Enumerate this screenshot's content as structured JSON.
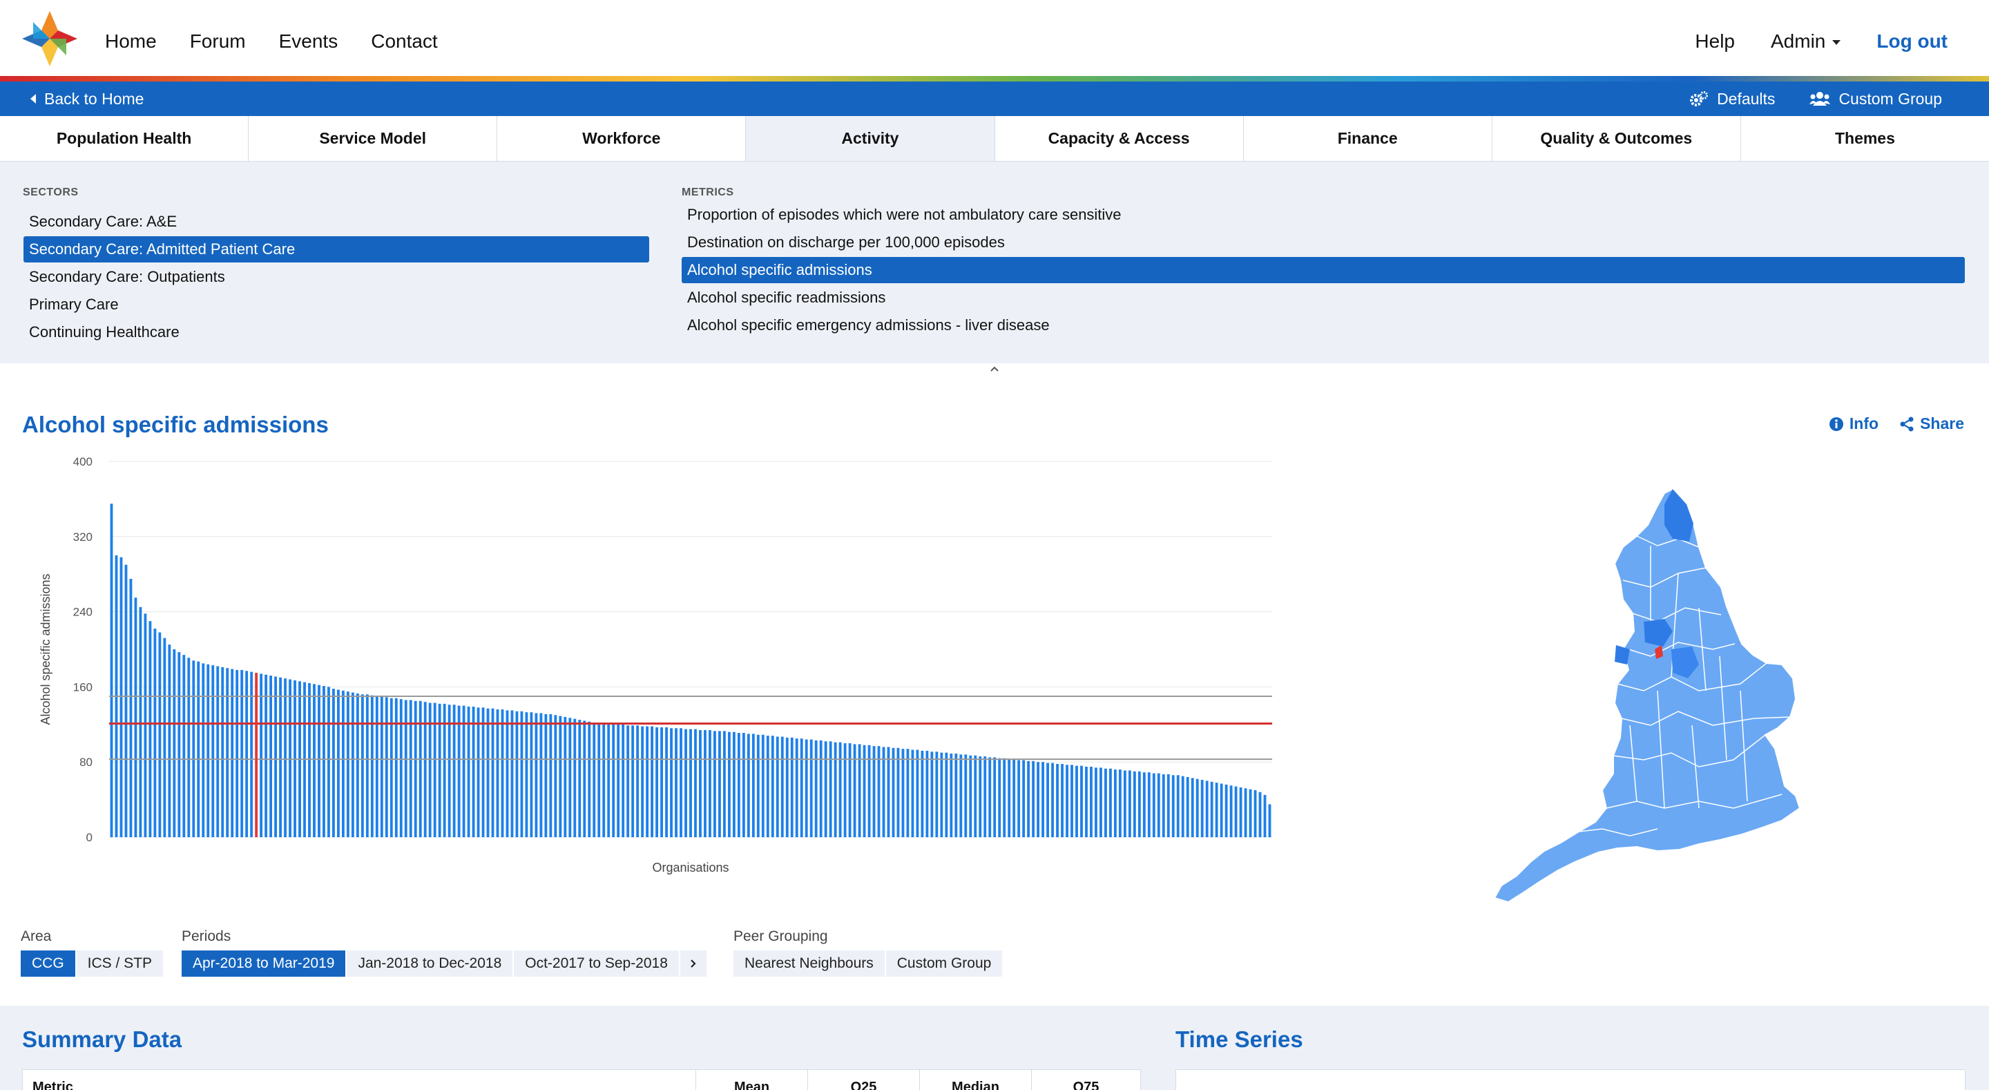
{
  "nav": {
    "left": [
      "Home",
      "Forum",
      "Events",
      "Contact"
    ],
    "help": "Help",
    "admin": "Admin",
    "logout": "Log out"
  },
  "bluebar": {
    "back": "Back to Home",
    "defaults": "Defaults",
    "custom_group": "Custom Group"
  },
  "tabs": [
    "Population Health",
    "Service Model",
    "Workforce",
    "Activity",
    "Capacity & Access",
    "Finance",
    "Quality & Outcomes",
    "Themes"
  ],
  "active_tab": "Activity",
  "sectors": {
    "title": "SECTORS",
    "items": [
      "Secondary Care: A&E",
      "Secondary Care: Admitted Patient Care",
      "Secondary Care: Outpatients",
      "Primary Care",
      "Continuing Healthcare"
    ],
    "selected_index": 1
  },
  "metrics": {
    "title": "METRICS",
    "items": [
      "Proportion of episodes which were not ambulatory care sensitive",
      "Destination on discharge per 100,000 episodes",
      "Alcohol specific admissions",
      "Alcohol specific readmissions",
      "Alcohol specific emergency admissions - liver disease"
    ],
    "selected_index": 2
  },
  "chart_header": {
    "title": "Alcohol specific admissions",
    "info": "Info",
    "share": "Share"
  },
  "chart_data": {
    "type": "bar",
    "xlabel": "Organisations",
    "ylabel": "Alcohol specific admissions",
    "ylim": [
      0,
      400
    ],
    "yticks": [
      "0",
      "80",
      "160",
      "240",
      "320",
      "400"
    ],
    "reference_lines": {
      "upper": 150,
      "mean": 121,
      "lower": 83
    },
    "highlight_index": 30,
    "bar_color": "#1e80e8",
    "highlight_color": "#e53935",
    "mean_color": "#d32f2f",
    "quartile_color": "#999999",
    "values": [
      355,
      300,
      298,
      290,
      275,
      255,
      245,
      238,
      230,
      222,
      218,
      212,
      205,
      200,
      197,
      194,
      191,
      188,
      187,
      185,
      184,
      183,
      182,
      181,
      180,
      179,
      178,
      178,
      177,
      176,
      175,
      174,
      173,
      172,
      171,
      170,
      169,
      168,
      167,
      166,
      165,
      164,
      163,
      162,
      161,
      160,
      158,
      157,
      156,
      155,
      154,
      153,
      152,
      152,
      151,
      150,
      150,
      149,
      148,
      148,
      147,
      146,
      146,
      145,
      145,
      144,
      143,
      143,
      142,
      142,
      141,
      141,
      140,
      140,
      139,
      139,
      138,
      138,
      137,
      137,
      136,
      136,
      135,
      135,
      134,
      134,
      133,
      133,
      132,
      132,
      131,
      131,
      130,
      129,
      128,
      127,
      126,
      125,
      124,
      123,
      122,
      122,
      121,
      121,
      120,
      120,
      120,
      119,
      119,
      119,
      118,
      118,
      118,
      117,
      117,
      117,
      116,
      116,
      116,
      115,
      115,
      115,
      114,
      114,
      114,
      113,
      113,
      113,
      112,
      112,
      111,
      111,
      110,
      110,
      109,
      109,
      108,
      108,
      107,
      107,
      106,
      106,
      105,
      105,
      104,
      104,
      103,
      103,
      102,
      102,
      101,
      101,
      100,
      100,
      99,
      99,
      98,
      98,
      97,
      97,
      96,
      96,
      95,
      95,
      94,
      94,
      93,
      93,
      92,
      92,
      91,
      91,
      90,
      90,
      89,
      89,
      88,
      88,
      87,
      87,
      86,
      86,
      85,
      85,
      84,
      84,
      83,
      83,
      82,
      82,
      81,
      81,
      80,
      80,
      79,
      79,
      78,
      78,
      77,
      77,
      76,
      76,
      75,
      75,
      74,
      74,
      73,
      73,
      72,
      72,
      71,
      71,
      70,
      70,
      69,
      69,
      68,
      68,
      67,
      67,
      66,
      66,
      65,
      64,
      63,
      62,
      61,
      60,
      59,
      58,
      57,
      56,
      55,
      54,
      53,
      52,
      51,
      50,
      48,
      45,
      35
    ]
  },
  "controls": {
    "area_label": "Area",
    "area_options": [
      "CCG",
      "ICS / STP"
    ],
    "area_selected": 0,
    "periods_label": "Periods",
    "period_options": [
      "Apr-2018 to Mar-2019",
      "Jan-2018 to Dec-2018",
      "Oct-2017 to Sep-2018"
    ],
    "period_selected": 0,
    "peer_label": "Peer Grouping",
    "peer_options": [
      "Nearest Neighbours",
      "Custom Group"
    ]
  },
  "summary": {
    "title": "Summary Data",
    "columns": [
      "Metric",
      "Mean",
      "Q25",
      "Median",
      "Q75"
    ]
  },
  "time_series": {
    "title": "Time Series"
  },
  "colors": {
    "brand_blue": "#1565c0",
    "panel_bg": "#edf1f7",
    "map_fill": "#6aa8f4",
    "map_dark": "#2f7be6",
    "map_highlight": "#e53935"
  },
  "icons": [
    "logo-icon",
    "caret-down-icon",
    "chevron-left-icon",
    "cogs-icon",
    "users-icon",
    "info-icon",
    "share-icon",
    "chevron-right-icon",
    "chevron-up-icon"
  ]
}
